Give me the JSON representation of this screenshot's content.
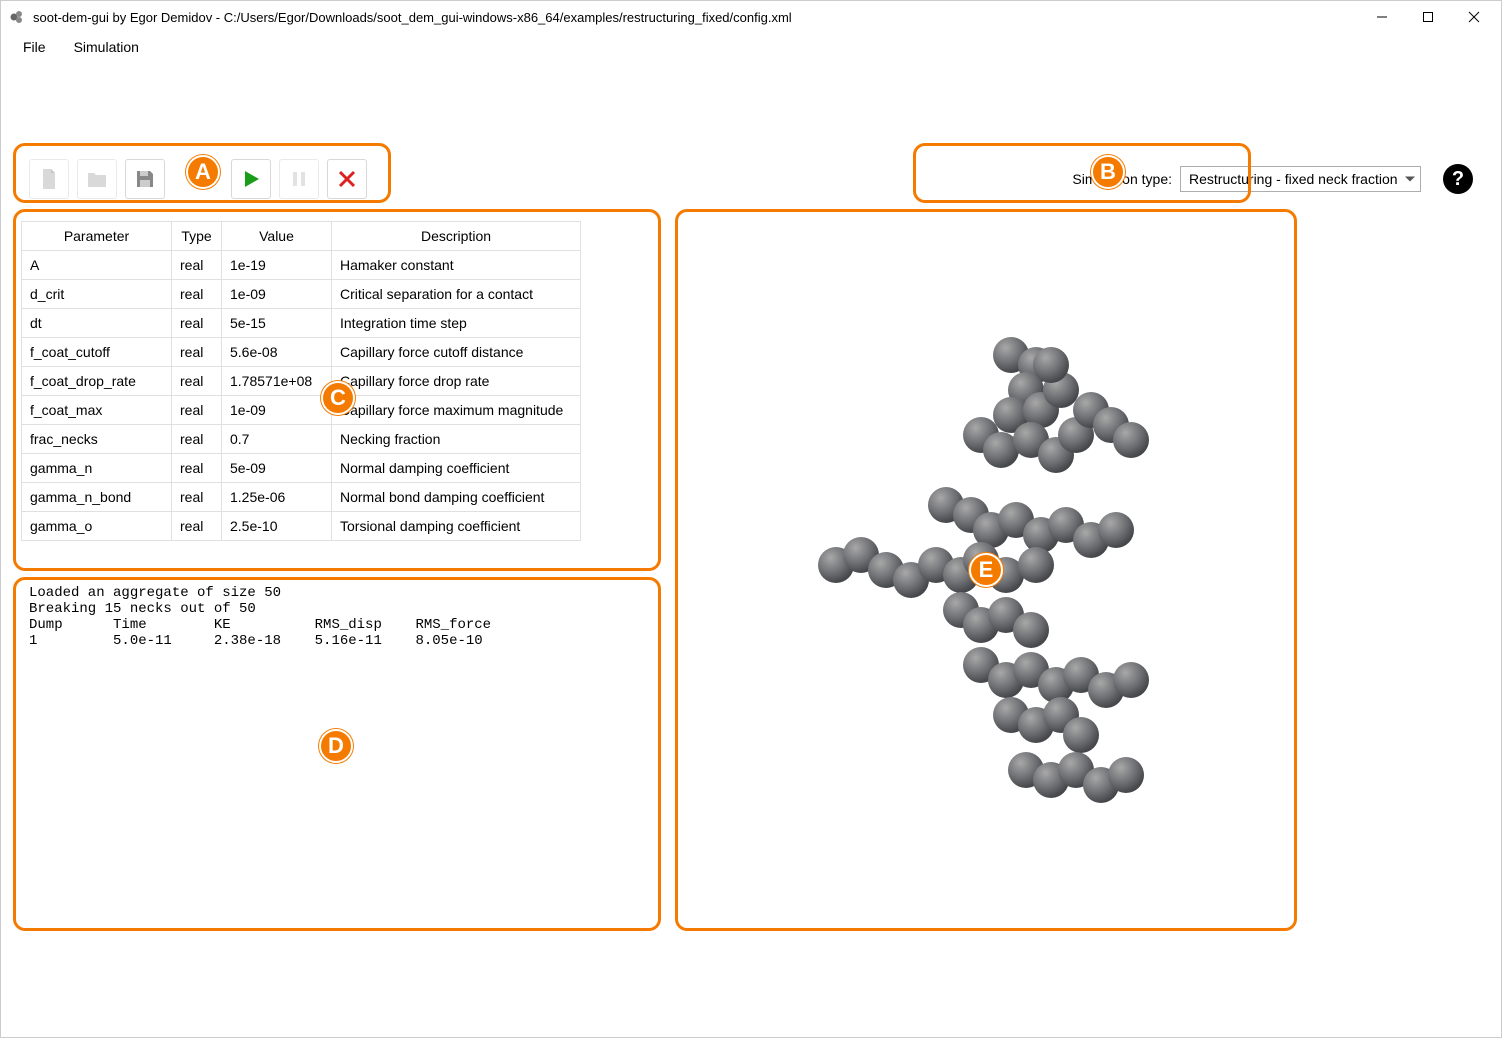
{
  "window": {
    "title": "soot-dem-gui by Egor Demidov - C:/Users/Egor/Downloads/soot_dem_gui-windows-x86_64/examples/restructuring_fixed/config.xml"
  },
  "menu": {
    "file": "File",
    "simulation": "Simulation"
  },
  "toolbar": {
    "sim_type_label": "Simulation type:",
    "sim_type_value": "Restructuring - fixed neck fraction",
    "help_label": "?"
  },
  "badges": {
    "a": "A",
    "b": "B",
    "c": "C",
    "d": "D",
    "e": "E"
  },
  "table": {
    "headers": {
      "parameter": "Parameter",
      "type": "Type",
      "value": "Value",
      "description": "Description"
    },
    "rows": [
      {
        "parameter": "A",
        "type": "real",
        "value": "1e-19",
        "description": "Hamaker constant"
      },
      {
        "parameter": "d_crit",
        "type": "real",
        "value": "1e-09",
        "description": "Critical separation for a contact"
      },
      {
        "parameter": "dt",
        "type": "real",
        "value": "5e-15",
        "description": "Integration time step"
      },
      {
        "parameter": "f_coat_cutoff",
        "type": "real",
        "value": "5.6e-08",
        "description": "Capillary force cutoff distance"
      },
      {
        "parameter": "f_coat_drop_rate",
        "type": "real",
        "value": "1.78571e+08",
        "description": "Capillary force drop rate"
      },
      {
        "parameter": "f_coat_max",
        "type": "real",
        "value": "1e-09",
        "description": "Capillary force maximum magnitude"
      },
      {
        "parameter": "frac_necks",
        "type": "real",
        "value": "0.7",
        "description": "Necking fraction"
      },
      {
        "parameter": "gamma_n",
        "type": "real",
        "value": "5e-09",
        "description": "Normal damping coefficient"
      },
      {
        "parameter": "gamma_n_bond",
        "type": "real",
        "value": "1.25e-06",
        "description": "Normal bond damping coefficient"
      },
      {
        "parameter": "gamma_o",
        "type": "real",
        "value": "2.5e-10",
        "description": "Torsional damping coefficient"
      }
    ]
  },
  "console": {
    "text": "Loaded an aggregate of size 50\nBreaking 15 necks out of 50\nDump      Time        KE          RMS_disp    RMS_force\n1         5.0e-11     2.38e-18    5.16e-11    8.05e-10"
  }
}
